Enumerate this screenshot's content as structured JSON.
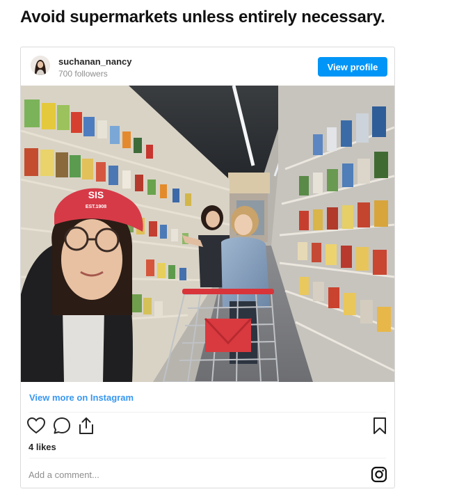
{
  "headline": "Avoid supermarkets unless entirely necessary.",
  "post": {
    "username": "suchanan_nancy",
    "followers": "700 followers",
    "view_profile_label": "View profile",
    "view_more_label": "View more on Instagram",
    "likes": "4 likes",
    "comment_placeholder": "Add a comment..."
  },
  "photo": {
    "cap_text": "SIS",
    "cap_subtext": "EST.1908"
  },
  "colors": {
    "accent": "#0095f6",
    "link": "#3897f0",
    "border": "#dbdbdb"
  },
  "icons": [
    "heart-icon",
    "comment-icon",
    "share-icon",
    "bookmark-icon",
    "instagram-icon"
  ]
}
